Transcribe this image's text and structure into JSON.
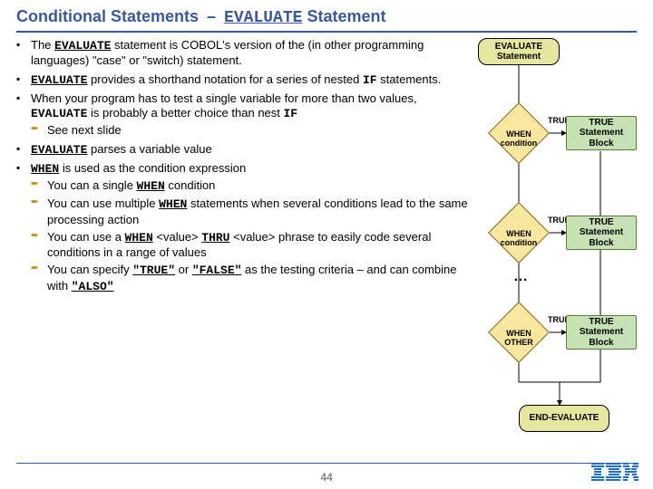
{
  "title": {
    "pre": "Conditional Statements ",
    "dash": "–",
    "kw": "EVALUATE",
    "post": " Statement"
  },
  "bullets": {
    "b1_a": "The ",
    "b1_kw": "EVALUATE",
    "b1_b": " statement is COBOL's version of the (in other programming languages) \"case\" or \"switch) statement.",
    "b2_kw": "EVALUATE",
    "b2_a": " provides a shorthand notation for a series of nested ",
    "b2_kw2": "IF",
    "b2_b": " statements.",
    "b3_a": "When your program has to test a single variable for more than two values, ",
    "b3_kw": "EVALUATE",
    "b3_b": " is probably a better choice than nest ",
    "b3_kw2": "IF",
    "b3_sub1": "See next slide",
    "b4_kw": "EVALUATE",
    "b4_a": " parses a variable value",
    "b5_kw": "WHEN",
    "b5_a": " is used as the condition expression",
    "b5_s1_a": "You can a single ",
    "b5_s1_kw": "WHEN",
    "b5_s1_b": " condition",
    "b5_s2_a": "You can use multiple ",
    "b5_s2_kw": "WHEN",
    "b5_s2_b": " statements when several conditions lead to the same processing action",
    "b5_s3_a": "You can use a ",
    "b5_s3_kw1": "WHEN",
    "b5_s3_mid1": " <value> ",
    "b5_s3_kw2": "THRU",
    "b5_s3_b": " <value> phrase to easily code several conditions in a range of values",
    "b5_s4_a": "You can specify ",
    "b5_s4_kw1": "\"TRUE\"",
    "b5_s4_mid": " or ",
    "b5_s4_kw2": "\"FALSE\"",
    "b5_s4_b": " as the testing criteria – and can combine with ",
    "b5_s4_kw3": "\"ALSO\""
  },
  "flow": {
    "start": "EVALUATE\nStatement",
    "cond1": "WHEN\ncondition",
    "cond2": "WHEN\ncondition",
    "cond3": "WHEN\nOTHER",
    "stmt": "TRUE\nStatement\nBlock",
    "end": "END-EVALUATE",
    "true": "TRUE",
    "dots": "…"
  },
  "page": "44",
  "logo": "IBM"
}
